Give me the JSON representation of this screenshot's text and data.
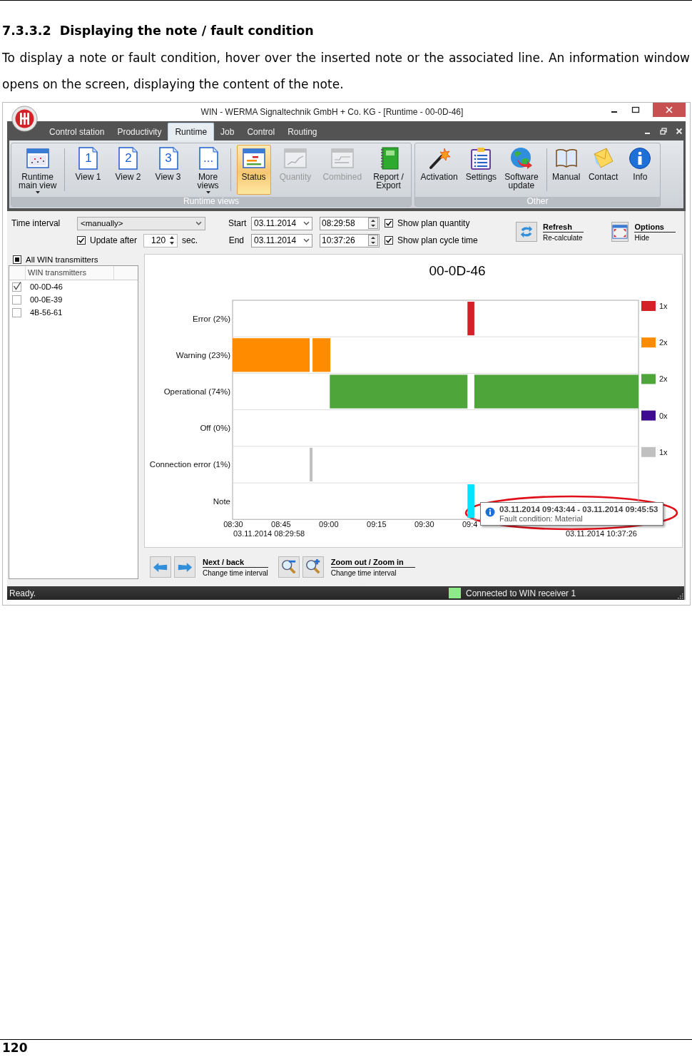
{
  "document": {
    "heading_number": "7.3.3.2",
    "heading": "Displaying the note / fault condition",
    "paragraph": "To display a note or fault condition, hover over the inserted note or the associated line. An information window opens on the screen, displaying the content of the note.",
    "page_number": "120"
  },
  "window": {
    "title": "WIN - WERMA Signaltechnik GmbH + Co. KG - [Runtime - 00-0D-46]"
  },
  "menu_tabs": [
    {
      "label": "Control station",
      "selected": false
    },
    {
      "label": "Productivity",
      "selected": false
    },
    {
      "label": "Runtime",
      "selected": true
    },
    {
      "label": "Job",
      "selected": false
    },
    {
      "label": "Control",
      "selected": false
    },
    {
      "label": "Routing",
      "selected": false
    }
  ],
  "ribbon_groups": [
    {
      "label": "Runtime views",
      "buttons": [
        {
          "label": "Runtime\nmain view",
          "dropdown": true,
          "selected": false,
          "disabled": false,
          "separator_after": true
        },
        {
          "label": "View 1",
          "icon_text": "1",
          "dropdown": false,
          "selected": false,
          "disabled": false,
          "separator_after": false
        },
        {
          "label": "View 2",
          "icon_text": "2",
          "dropdown": false,
          "selected": false,
          "disabled": false,
          "separator_after": false
        },
        {
          "label": "View 3",
          "icon_text": "3",
          "dropdown": false,
          "selected": false,
          "disabled": false,
          "separator_after": false
        },
        {
          "label": "More\nviews",
          "icon_text": "...",
          "dropdown": true,
          "selected": false,
          "disabled": false,
          "separator_after": true
        },
        {
          "label": "Status",
          "dropdown": false,
          "selected": true,
          "disabled": false,
          "separator_after": false
        },
        {
          "label": "Quantity",
          "dropdown": false,
          "selected": false,
          "disabled": true,
          "separator_after": false
        },
        {
          "label": "Combined",
          "dropdown": false,
          "selected": false,
          "disabled": true,
          "separator_after": false
        },
        {
          "label": "Report /\nExport",
          "dropdown": false,
          "selected": false,
          "disabled": false,
          "separator_after": false
        }
      ]
    },
    {
      "label": "Other",
      "buttons": [
        {
          "label": "Activation",
          "dropdown": false,
          "selected": false,
          "disabled": false,
          "separator_after": false
        },
        {
          "label": "Settings",
          "dropdown": false,
          "selected": false,
          "disabled": false,
          "separator_after": false
        },
        {
          "label": "Software\nupdate",
          "dropdown": false,
          "selected": false,
          "disabled": false,
          "separator_after": true
        },
        {
          "label": "Manual",
          "dropdown": false,
          "selected": false,
          "disabled": false,
          "separator_after": false
        },
        {
          "label": "Contact",
          "dropdown": false,
          "selected": false,
          "disabled": false,
          "separator_after": false
        },
        {
          "label": "Info",
          "dropdown": false,
          "selected": false,
          "disabled": false,
          "separator_after": false
        }
      ]
    }
  ],
  "toolbar": {
    "time_interval_label": "Time interval",
    "interval_select": "<manually>",
    "update_after": {
      "label": "Update after",
      "checked": true
    },
    "update_value": "120",
    "update_unit": "sec.",
    "start_label": "Start",
    "start_date": "03.11.2014",
    "start_time": "08:29:58",
    "end_label": "End",
    "end_date": "03.11.2014",
    "end_time": "10:37:26",
    "options": [
      {
        "label": "Show plan quantity",
        "checked": true
      },
      {
        "label": "Show plan cycle time",
        "checked": true
      }
    ],
    "actions": [
      {
        "title": "Refresh",
        "subtitle": "Re-calculate"
      },
      {
        "title": "Options",
        "subtitle": "Hide"
      }
    ]
  },
  "transmitters": {
    "all_label": "All WIN transmitters",
    "all_partial": true,
    "column": "WIN transmitters",
    "items": [
      {
        "name": "00-0D-46",
        "checked": true
      },
      {
        "name": "00-0E-39",
        "checked": false
      },
      {
        "name": "4B-56-61",
        "checked": false
      }
    ]
  },
  "chart": {
    "title": "00-0D-46",
    "rows": [
      {
        "label": "Error (2%)",
        "color": "#d42027",
        "count": "1x"
      },
      {
        "label": "Warning (23%)",
        "color": "#ff8c00",
        "count": "2x"
      },
      {
        "label": "Operational (74%)",
        "color": "#4ea53a",
        "count": "2x"
      },
      {
        "label": "Off (0%)",
        "color": "#3d0a91",
        "count": "0x"
      },
      {
        "label": "Connection error (1%)",
        "color": "#c0c0c0",
        "count": "1x"
      },
      {
        "label": "Note",
        "color": "#00e5ff"
      }
    ],
    "ticks": [
      "08:30",
      "08:45",
      "09:00",
      "09:15",
      "09:30",
      "09:4"
    ],
    "start_label": "03.11.2014 08:29:58",
    "end_label": "03.11.2014 10:37:26",
    "tooltip": {
      "title": "03.11.2014 09:43:44 - 03.11.2014 09:45:53",
      "text": "Fault condition: Material"
    }
  },
  "navigation": [
    {
      "title": "Next / back",
      "subtitle": "Change time interval"
    },
    {
      "title": "Zoom out / Zoom in",
      "subtitle": "Change time interval"
    }
  ],
  "status_bar": {
    "text": "Ready.",
    "connection": "Connected to WIN receiver 1"
  }
}
